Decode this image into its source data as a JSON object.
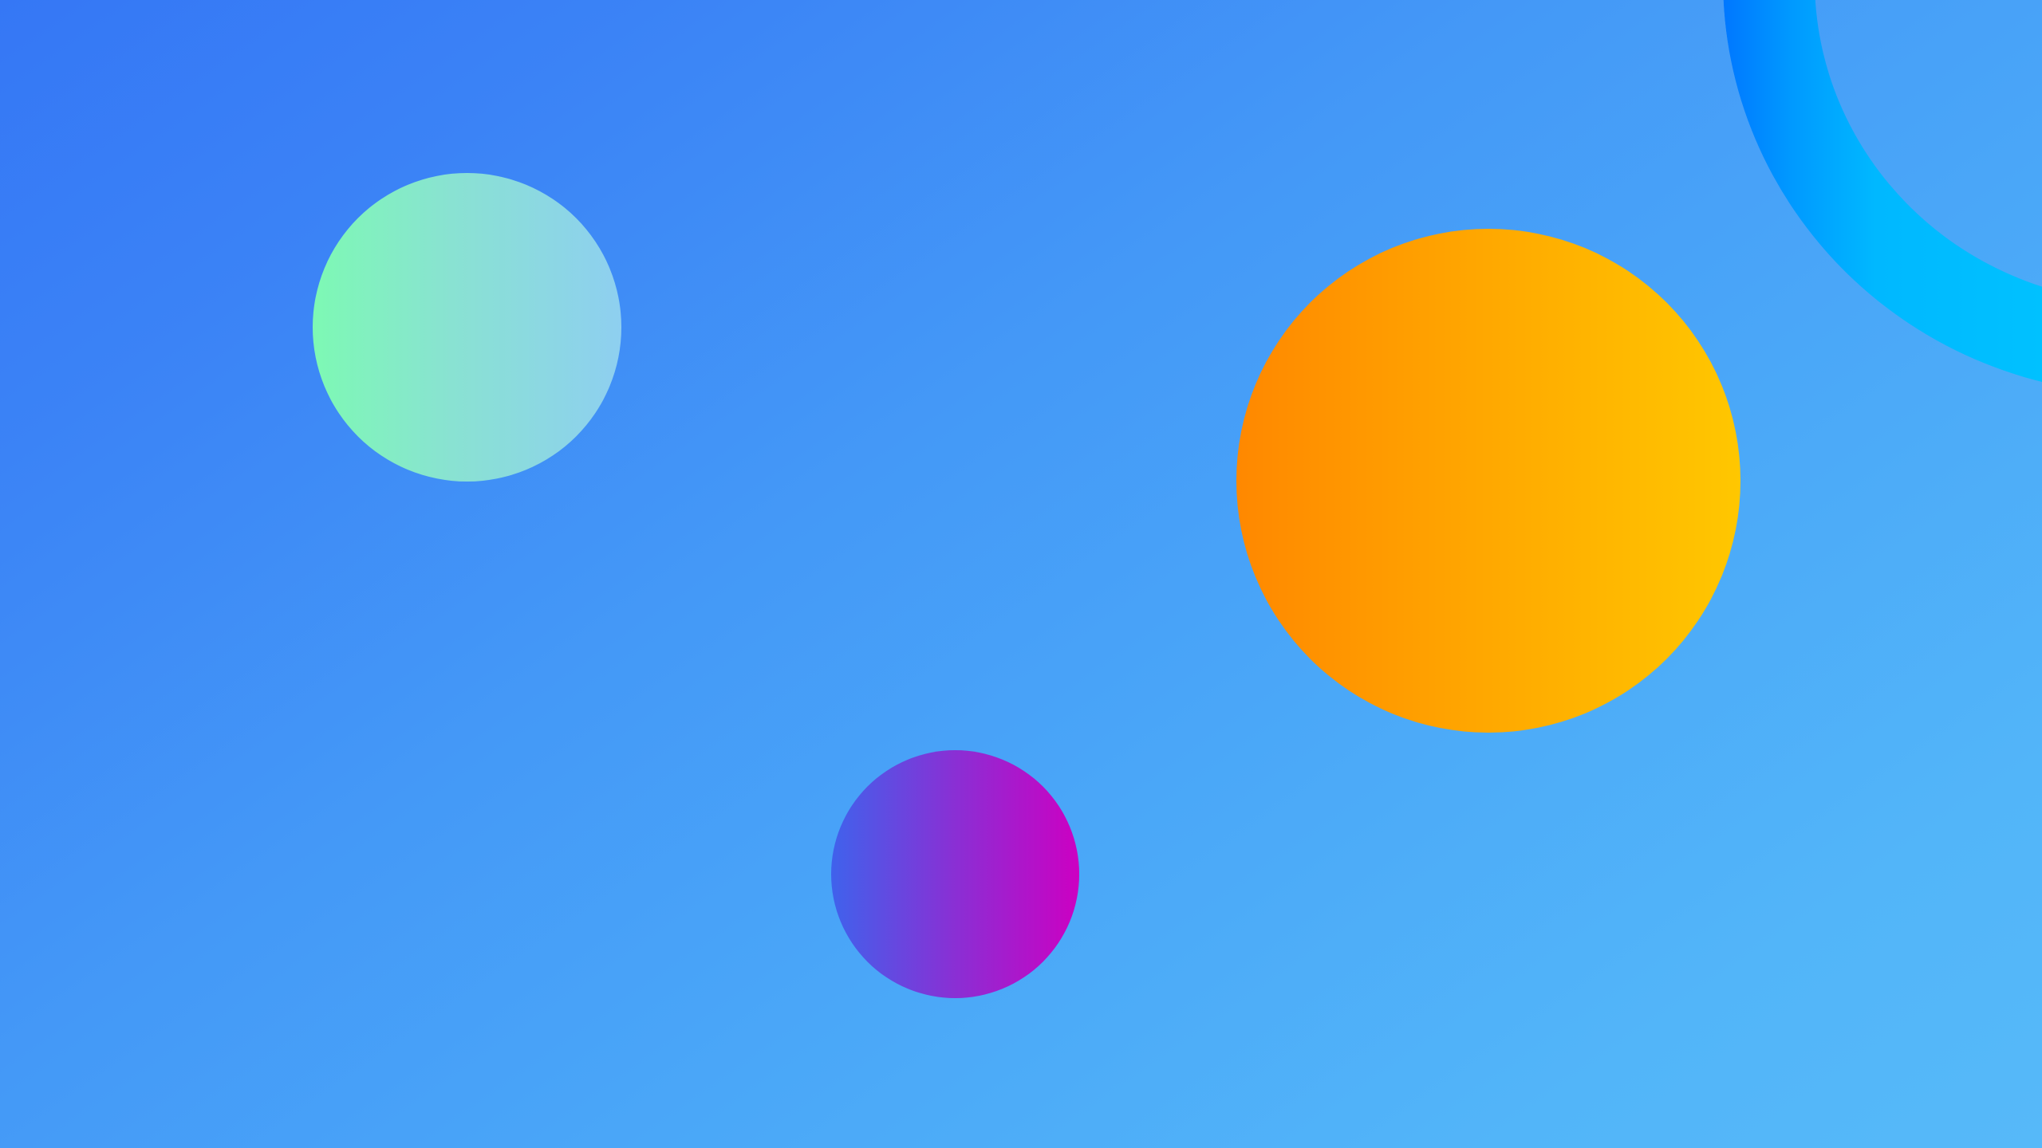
{
  "desktop": {
    "wallpaper": {
      "colors": {
        "background_start": "#3577f5",
        "background_end": "#56b9f9",
        "mint_orb": [
          "#7df9b4",
          "#8ecff0"
        ],
        "orange_orb": [
          "#ff8800",
          "#ffc700"
        ],
        "magenta_orb": [
          "#3f62ec",
          "#cc00c2"
        ],
        "ring": [
          "#0077ff",
          "#00c2ff"
        ]
      }
    }
  }
}
